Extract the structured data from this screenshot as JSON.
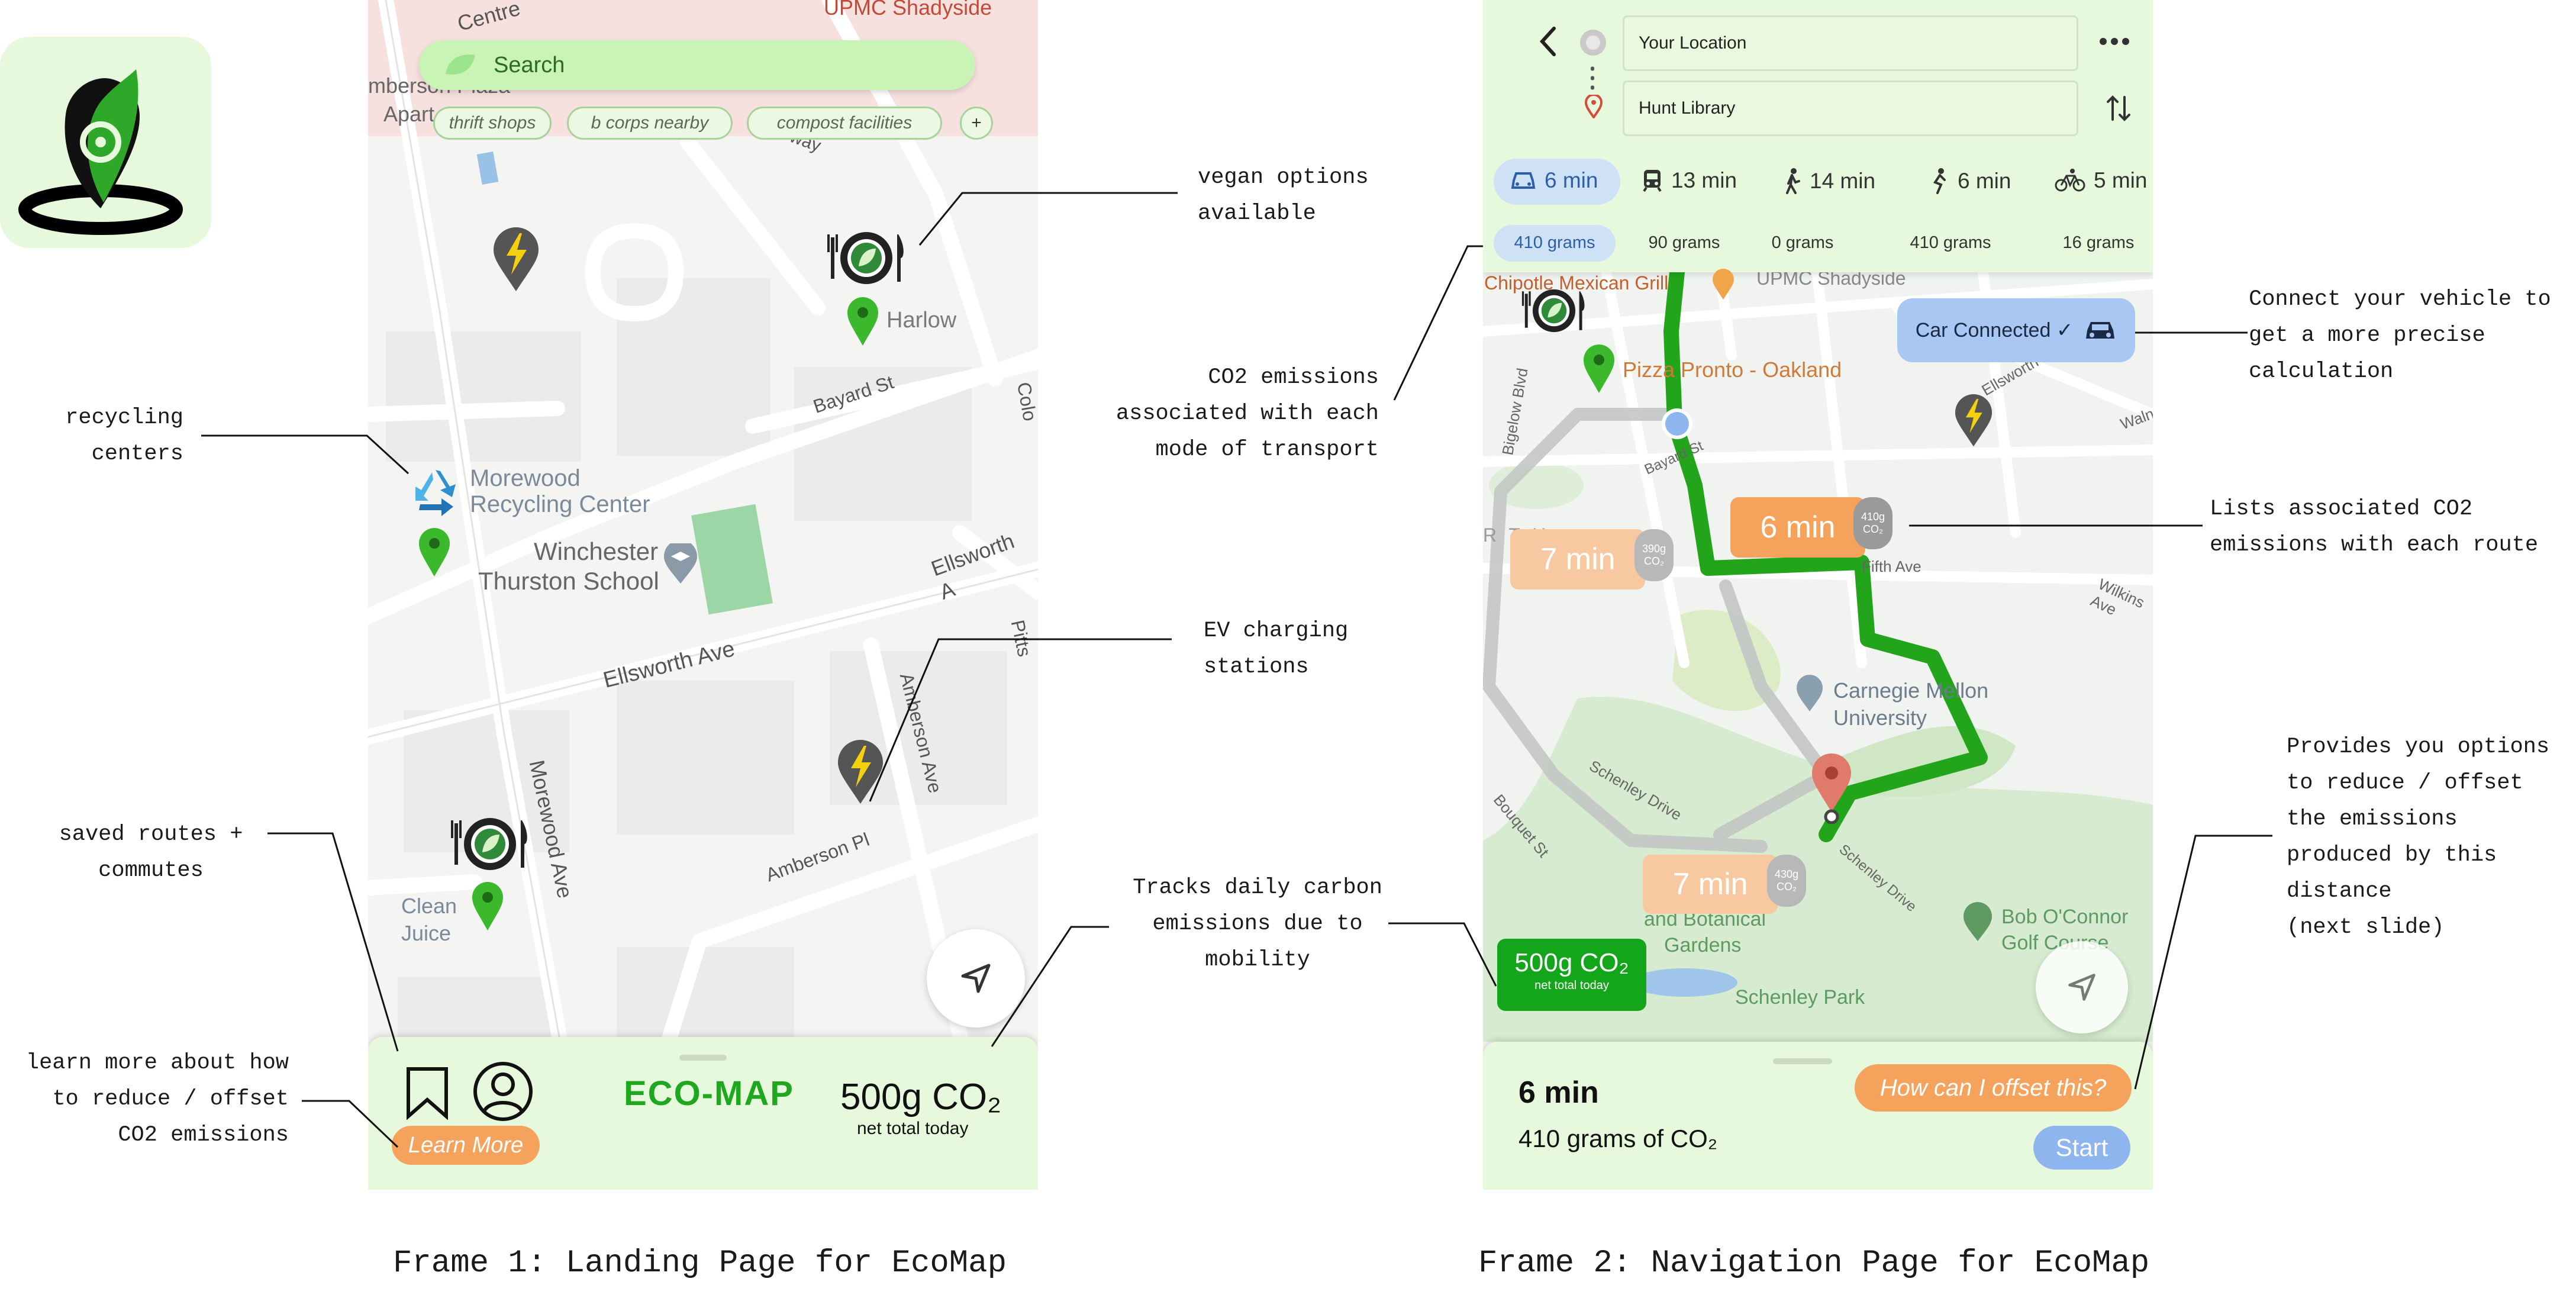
{
  "frame1": {
    "search_placeholder": "Search",
    "chips": [
      "thrift shops",
      "b corps nearby",
      "compost facilities",
      "+"
    ],
    "map_labels": {
      "top1": "Centre",
      "top2": "UPMC Shadyside",
      "top3": "mberson Plaza",
      "top4": "Apart",
      "top5": "way",
      "harlow": "Harlow",
      "bayard": "Bayard St",
      "morewood_recycling_1": "Morewood",
      "morewood_recycling_2": "Recycling Center",
      "winchester_1": "Winchester",
      "winchester_2": "Thurston School",
      "ellsworth1": "Ellsworth Ave",
      "ellsworth2": "Ellsworth A",
      "amberson_ave": "Amberson Ave",
      "amberson_pl": "Amberson Pl",
      "morewood_ave": "Morewood Ave",
      "clean_juice_1": "Clean",
      "clean_juice_2": "Juice",
      "colo": "Colo",
      "pitts": "Pitts"
    },
    "bottom": {
      "brand": "ECO-MAP",
      "co2_value": "500g CO₂",
      "co2_sub": "net total today",
      "learn_more": "Learn More"
    },
    "caption": "Frame 1: Landing Page for EcoMap"
  },
  "frame2": {
    "origin": "Your Location",
    "destination": "Hunt Library",
    "modes": [
      {
        "icon": "car-icon",
        "time": "6 min",
        "grams": "410 grams"
      },
      {
        "icon": "train-icon",
        "time": "13 min",
        "grams": "90 grams"
      },
      {
        "icon": "walk-icon",
        "time": "14 min",
        "grams": "0 grams"
      },
      {
        "icon": "scooter-icon",
        "time": "6 min",
        "grams": "410 grams"
      },
      {
        "icon": "bike-icon",
        "time": "5 min",
        "grams": "16 grams"
      }
    ],
    "car_connected": "Car Connected ✓",
    "map_labels": {
      "chipotle": "Chipotle Mexican Grill",
      "upmc": "UPMC Shadyside",
      "pizza": "Pizza Pronto - Oakland",
      "bigelow": "Bigelow Blvd",
      "ellsworth": "Ellsworth",
      "walnut": "Walnu",
      "bayard": "Bayard St",
      "rth": "R T H",
      "fifth": "Fifth Ave",
      "wilkins": "Wilkins Ave",
      "cmu1": "Carnegie Mellon",
      "cmu2": "University",
      "schenley_dr": "Schenley Drive",
      "schenley_dr2": "Schenley Drive",
      "bouquet": "Bouquet St",
      "bob1": "Bob O'Connor",
      "bob2": "Golf Course",
      "botanical1": "and Botanical",
      "botanical2": "Gardens",
      "schenley_park": "Schenley Park"
    },
    "routes": [
      {
        "time": "6 min",
        "co2": "410g CO₂"
      },
      {
        "time": "7 min",
        "co2": "390g CO₂"
      },
      {
        "time": "7 min",
        "co2": "430g CO₂"
      }
    ],
    "badge": {
      "value": "500g CO₂",
      "sub": "net total today"
    },
    "bottom": {
      "time": "6 min",
      "grams": "410 grams of CO₂",
      "offset": "How can I offset this?",
      "start": "Start"
    },
    "caption": "Frame 2: Navigation Page for EcoMap"
  },
  "annotations": {
    "vegan": "vegan options\navailable",
    "recycling": "recycling\ncenters",
    "ev": "EV charging\nstations",
    "saved": "saved routes +\ncommutes",
    "learn": "learn more about how\nto reduce / offset\nCO2 emissions",
    "tracks": "Tracks daily carbon\nemissions due to\nmobility",
    "co2modes": "CO2 emissions\nassociated with each\nmode of transport",
    "connect": "Connect your vehicle to\nget a more precise\ncalculation",
    "lists": "Lists associated CO2\nemissions with each route",
    "provides": "Provides you options\nto reduce / offset\nthe emissions\nproduced by this\ndistance\n(next slide)"
  },
  "colors": {
    "brand_green": "#1fa81f",
    "panel_green": "#e7f9dc",
    "orange": "#f5a35c",
    "blue": "#8fb5ee",
    "route_green": "#23a51b"
  }
}
